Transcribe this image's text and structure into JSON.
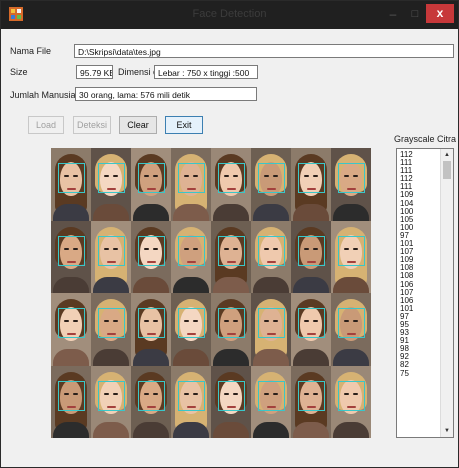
{
  "window": {
    "title": "Face Detection"
  },
  "form": {
    "nama_file_label": "Nama File",
    "nama_file_value": "D:\\Skripsi\\data\\tes.jpg",
    "size_label": "Size",
    "size_value": "95.79 KB",
    "dimensi_label": "Dimensi citra",
    "dimensi_value": "Lebar : 750 x tinggi :500",
    "jumlah_label": "Jumlah Manusia",
    "jumlah_value": "30 orang,  lama: 576 mili detik"
  },
  "buttons": {
    "load": "Load",
    "deteksi": "Deteksi",
    "clear": "Clear",
    "exit": "Exit"
  },
  "grayscale": {
    "label": "Grayscale Citra",
    "values": [
      "112",
      "111",
      "111",
      "112",
      "111",
      "109",
      "104",
      "100",
      "105",
      "100",
      "97",
      "101",
      "107",
      "109",
      "108",
      "108",
      "106",
      "107",
      "106",
      "101",
      "97",
      "95",
      "93",
      "91",
      "98",
      "92",
      "82",
      "75"
    ]
  },
  "colors": {
    "titlebar": "#202020",
    "close": "#c7383a",
    "detect_box": "#39c7c9"
  }
}
